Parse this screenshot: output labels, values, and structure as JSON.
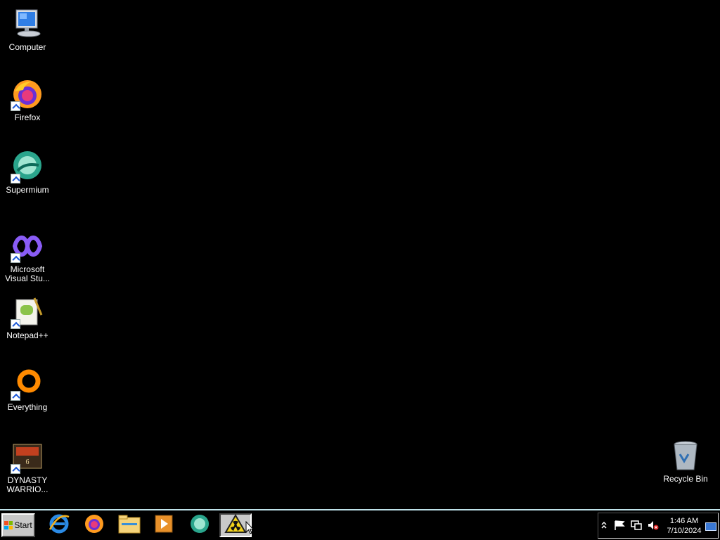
{
  "desktop": {
    "icons": [
      {
        "label": "Computer",
        "icon": "computer-icon",
        "shortcut": false
      },
      {
        "label": "Firefox",
        "icon": "firefox-icon",
        "shortcut": true
      },
      {
        "label": "Supermium",
        "icon": "supermium-icon",
        "shortcut": true
      },
      {
        "label": "Microsoft\nVisual Stu...",
        "icon": "visual-studio-icon",
        "shortcut": true
      },
      {
        "label": "Notepad++",
        "icon": "notepad-plus-plus-icon",
        "shortcut": true
      },
      {
        "label": "Everything",
        "icon": "everything-search-icon",
        "shortcut": true
      },
      {
        "label": "DYNASTY\nWARRIO...",
        "icon": "dynasty-warriors-icon",
        "shortcut": true
      }
    ],
    "recycle_bin": {
      "label": "Recycle Bin",
      "icon": "recycle-bin-icon"
    }
  },
  "taskbar": {
    "start_label": "Start",
    "pinned": [
      {
        "name": "internet-explorer",
        "icon": "internet-explorer-icon",
        "active": false
      },
      {
        "name": "firefox",
        "icon": "firefox-icon",
        "active": false
      },
      {
        "name": "file-explorer",
        "icon": "folder-icon",
        "active": false
      },
      {
        "name": "media-player",
        "icon": "media-player-icon",
        "active": false
      },
      {
        "name": "supermium",
        "icon": "supermium-icon",
        "active": false
      },
      {
        "name": "radiation-app",
        "icon": "radiation-warning-icon",
        "active": true
      }
    ],
    "tray": {
      "icons": [
        "chevron-up-icon",
        "flag-icon",
        "network-icon",
        "volume-muted-icon"
      ],
      "time": "1:46 AM",
      "date": "7/10/2024"
    }
  },
  "colors": {
    "desktop_bg": "#000000",
    "taskbar_border": "#bfe3ea",
    "start_button": "#c7c7c7"
  }
}
